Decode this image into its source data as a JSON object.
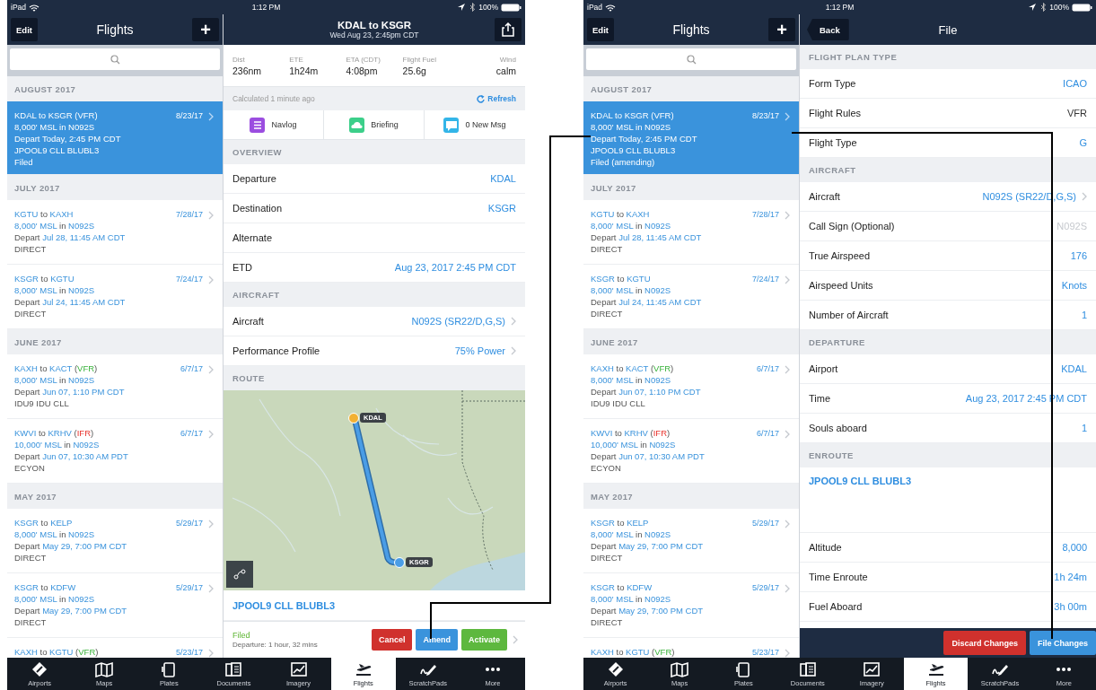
{
  "screens": [
    {
      "kind": "flight",
      "status_bar": {
        "device": "iPad",
        "time": "1:12 PM",
        "battery": "100%"
      },
      "list": {
        "edit": "Edit",
        "title": "Flights",
        "add": "+",
        "sections": [
          {
            "header": "AUGUST 2017",
            "flights": [
              {
                "selected": true,
                "date": "8/23/17",
                "lines": [
                  [
                    {
                      "text": "KDAL to KSGR (VFR)",
                      "kind": "text"
                    }
                  ],
                  [
                    {
                      "text": "8,000' MSL in N092S",
                      "kind": "text"
                    }
                  ],
                  [
                    {
                      "text": "Depart Today, 2:45 PM CDT",
                      "kind": "text"
                    }
                  ],
                  [
                    {
                      "text": "JPOOL9 CLL BLUBL3",
                      "kind": "text"
                    }
                  ],
                  [
                    {
                      "text": "Filed",
                      "kind": "text"
                    }
                  ]
                ]
              }
            ]
          },
          {
            "header": "JULY 2017",
            "flights": [
              {
                "selected": false,
                "date": "7/28/17",
                "lines": [
                  [
                    {
                      "text": "KGTU",
                      "kind": "id"
                    },
                    {
                      "text": " to ",
                      "kind": "text"
                    },
                    {
                      "text": "KAXH",
                      "kind": "id"
                    }
                  ],
                  [
                    {
                      "text": "8,000' MSL",
                      "kind": "id"
                    },
                    {
                      "text": " in ",
                      "kind": "text"
                    },
                    {
                      "text": "N092S",
                      "kind": "id"
                    }
                  ],
                  [
                    {
                      "text": "Depart ",
                      "kind": "text"
                    },
                    {
                      "text": "Jul 28, 11:45 AM CDT",
                      "kind": "id"
                    }
                  ],
                  [
                    {
                      "text": "DIRECT",
                      "kind": "text"
                    }
                  ]
                ]
              },
              {
                "selected": false,
                "date": "7/24/17",
                "lines": [
                  [
                    {
                      "text": "KSGR",
                      "kind": "id"
                    },
                    {
                      "text": " to ",
                      "kind": "text"
                    },
                    {
                      "text": "KGTU",
                      "kind": "id"
                    }
                  ],
                  [
                    {
                      "text": "8,000' MSL",
                      "kind": "id"
                    },
                    {
                      "text": " in ",
                      "kind": "text"
                    },
                    {
                      "text": "N092S",
                      "kind": "id"
                    }
                  ],
                  [
                    {
                      "text": "Depart ",
                      "kind": "text"
                    },
                    {
                      "text": "Jul 24, 11:45 AM CDT",
                      "kind": "id"
                    }
                  ],
                  [
                    {
                      "text": "DIRECT",
                      "kind": "text"
                    }
                  ]
                ]
              }
            ]
          },
          {
            "header": "JUNE 2017",
            "flights": [
              {
                "selected": false,
                "date": "6/7/17",
                "lines": [
                  [
                    {
                      "text": "KAXH",
                      "kind": "id"
                    },
                    {
                      "text": " to ",
                      "kind": "text"
                    },
                    {
                      "text": "KACT",
                      "kind": "id"
                    },
                    {
                      "text": " (",
                      "kind": "text"
                    },
                    {
                      "text": "VFR",
                      "kind": "vfr"
                    },
                    {
                      "text": ")",
                      "kind": "text"
                    }
                  ],
                  [
                    {
                      "text": "8,000' MSL",
                      "kind": "id"
                    },
                    {
                      "text": " in ",
                      "kind": "text"
                    },
                    {
                      "text": "N092S",
                      "kind": "id"
                    }
                  ],
                  [
                    {
                      "text": "Depart ",
                      "kind": "text"
                    },
                    {
                      "text": "Jun 07, 1:10 PM CDT",
                      "kind": "id"
                    }
                  ],
                  [
                    {
                      "text": "IDU9 IDU CLL",
                      "kind": "text"
                    }
                  ]
                ]
              },
              {
                "selected": false,
                "date": "6/7/17",
                "lines": [
                  [
                    {
                      "text": "KWVI",
                      "kind": "id"
                    },
                    {
                      "text": " to ",
                      "kind": "text"
                    },
                    {
                      "text": "KRHV",
                      "kind": "id"
                    },
                    {
                      "text": " (",
                      "kind": "text"
                    },
                    {
                      "text": "IFR",
                      "kind": "ifr"
                    },
                    {
                      "text": ")",
                      "kind": "text"
                    }
                  ],
                  [
                    {
                      "text": "10,000' MSL",
                      "kind": "id"
                    },
                    {
                      "text": " in ",
                      "kind": "text"
                    },
                    {
                      "text": "N092S",
                      "kind": "id"
                    }
                  ],
                  [
                    {
                      "text": "Depart ",
                      "kind": "text"
                    },
                    {
                      "text": "Jun 07, 10:30 AM PDT",
                      "kind": "id"
                    }
                  ],
                  [
                    {
                      "text": "ECYON",
                      "kind": "text"
                    }
                  ]
                ]
              }
            ]
          },
          {
            "header": "MAY 2017",
            "flights": [
              {
                "selected": false,
                "date": "5/29/17",
                "lines": [
                  [
                    {
                      "text": "KSGR",
                      "kind": "id"
                    },
                    {
                      "text": " to ",
                      "kind": "text"
                    },
                    {
                      "text": "KELP",
                      "kind": "id"
                    }
                  ],
                  [
                    {
                      "text": "8,000' MSL",
                      "kind": "id"
                    },
                    {
                      "text": " in ",
                      "kind": "text"
                    },
                    {
                      "text": "N092S",
                      "kind": "id"
                    }
                  ],
                  [
                    {
                      "text": "Depart ",
                      "kind": "text"
                    },
                    {
                      "text": "May 29, 7:00 PM CDT",
                      "kind": "id"
                    }
                  ],
                  [
                    {
                      "text": "DIRECT",
                      "kind": "text"
                    }
                  ]
                ]
              },
              {
                "selected": false,
                "date": "5/29/17",
                "lines": [
                  [
                    {
                      "text": "KSGR",
                      "kind": "id"
                    },
                    {
                      "text": " to ",
                      "kind": "text"
                    },
                    {
                      "text": "KDFW",
                      "kind": "id"
                    }
                  ],
                  [
                    {
                      "text": "8,000' MSL",
                      "kind": "id"
                    },
                    {
                      "text": " in ",
                      "kind": "text"
                    },
                    {
                      "text": "N092S",
                      "kind": "id"
                    }
                  ],
                  [
                    {
                      "text": "Depart ",
                      "kind": "text"
                    },
                    {
                      "text": "May 29, 7:00 PM CDT",
                      "kind": "id"
                    }
                  ],
                  [
                    {
                      "text": "DIRECT",
                      "kind": "text"
                    }
                  ]
                ]
              },
              {
                "selected": false,
                "date": "5/23/17",
                "lines": [
                  [
                    {
                      "text": "KAXH",
                      "kind": "id"
                    },
                    {
                      "text": " to ",
                      "kind": "text"
                    },
                    {
                      "text": "KGTU",
                      "kind": "id"
                    },
                    {
                      "text": " (",
                      "kind": "text"
                    },
                    {
                      "text": "VFR",
                      "kind": "vfr"
                    },
                    {
                      "text": ")",
                      "kind": "text"
                    }
                  ]
                ]
              }
            ]
          }
        ]
      },
      "detail": {
        "title": "KDAL to KSGR",
        "subtitle": "Wed Aug 23, 2:45pm CDT",
        "stats": [
          {
            "label": "Dist",
            "value": "236nm"
          },
          {
            "label": "ETE",
            "value": "1h24m"
          },
          {
            "label": "ETA (CDT)",
            "value": "4:08pm"
          },
          {
            "label": "Flight Fuel",
            "value": "25.6g"
          },
          {
            "label": "Wind",
            "value": "calm"
          }
        ],
        "calculated": "Calculated 1 minute ago",
        "refresh": "Refresh",
        "tiles": [
          {
            "label": "Navlog",
            "kind": "navlog",
            "color": "#9b4de0"
          },
          {
            "label": "Briefing",
            "kind": "briefing",
            "color": "#3ccf8a"
          },
          {
            "label": "0 New Msg",
            "kind": "messages",
            "color": "#33b5e8"
          }
        ],
        "sections": [
          {
            "header": "OVERVIEW",
            "rows": [
              {
                "label": "Departure",
                "value": "KDAL",
                "kind": "link",
                "chevron": false
              },
              {
                "label": "Destination",
                "value": "KSGR",
                "kind": "link",
                "chevron": false
              },
              {
                "label": "Alternate",
                "chevron": false
              },
              {
                "label": "ETD",
                "value": "Aug 23, 2017 2:45 PM CDT",
                "kind": "link",
                "chevron": false
              }
            ]
          },
          {
            "header": "AIRCRAFT",
            "rows": [
              {
                "label": "Aircraft",
                "value": "N092S (SR22/D,G,S)",
                "kind": "link",
                "chevron": true
              },
              {
                "label": "Performance Profile",
                "value": "75% Power",
                "kind": "link",
                "chevron": true
              }
            ]
          },
          {
            "header": "ROUTE",
            "map": {
              "origin": "KDAL",
              "destination": "KSGR"
            },
            "route": "JPOOL9 CLL BLUBL3"
          }
        ],
        "footer": {
          "status": "Filed",
          "note": "Departure: 1 hour, 32 mins",
          "chevron": true,
          "buttons": [
            {
              "label": "Cancel",
              "kind": "danger"
            },
            {
              "label": "Amend",
              "kind": "primary"
            },
            {
              "label": "Activate",
              "kind": "success"
            }
          ]
        }
      },
      "tabs": [
        {
          "label": "Airports",
          "kind": "airports",
          "selected": false
        },
        {
          "label": "Maps",
          "kind": "maps",
          "selected": false
        },
        {
          "label": "Plates",
          "kind": "plates",
          "selected": false
        },
        {
          "label": "Documents",
          "kind": "documents",
          "selected": false
        },
        {
          "label": "Imagery",
          "kind": "imagery",
          "selected": false
        },
        {
          "label": "Flights",
          "kind": "flights",
          "selected": true
        },
        {
          "label": "ScratchPads",
          "kind": "scratchpads",
          "selected": false
        },
        {
          "label": "More",
          "kind": "more",
          "selected": false
        }
      ]
    },
    {
      "kind": "form",
      "status_bar": {
        "device": "iPad",
        "time": "1:12 PM",
        "battery": "100%"
      },
      "list": {
        "edit": "Edit",
        "title": "Flights",
        "add": "+",
        "sections": [
          {
            "header": "AUGUST 2017",
            "flights": [
              {
                "selected": true,
                "date": "8/23/17",
                "lines": [
                  [
                    {
                      "text": "KDAL to KSGR (VFR)",
                      "kind": "text"
                    }
                  ],
                  [
                    {
                      "text": "8,000' MSL in N092S",
                      "kind": "text"
                    }
                  ],
                  [
                    {
                      "text": "Depart Today, 2:45 PM CDT",
                      "kind": "text"
                    }
                  ],
                  [
                    {
                      "text": "JPOOL9 CLL BLUBL3",
                      "kind": "text"
                    }
                  ],
                  [
                    {
                      "text": "Filed (amending)",
                      "kind": "text"
                    }
                  ]
                ]
              }
            ]
          },
          {
            "header": "JULY 2017",
            "flights": [
              {
                "selected": false,
                "date": "7/28/17",
                "lines": [
                  [
                    {
                      "text": "KGTU",
                      "kind": "id"
                    },
                    {
                      "text": " to ",
                      "kind": "text"
                    },
                    {
                      "text": "KAXH",
                      "kind": "id"
                    }
                  ],
                  [
                    {
                      "text": "8,000' MSL",
                      "kind": "id"
                    },
                    {
                      "text": " in ",
                      "kind": "text"
                    },
                    {
                      "text": "N092S",
                      "kind": "id"
                    }
                  ],
                  [
                    {
                      "text": "Depart ",
                      "kind": "text"
                    },
                    {
                      "text": "Jul 28, 11:45 AM CDT",
                      "kind": "id"
                    }
                  ],
                  [
                    {
                      "text": "DIRECT",
                      "kind": "text"
                    }
                  ]
                ]
              },
              {
                "selected": false,
                "date": "7/24/17",
                "lines": [
                  [
                    {
                      "text": "KSGR",
                      "kind": "id"
                    },
                    {
                      "text": " to ",
                      "kind": "text"
                    },
                    {
                      "text": "KGTU",
                      "kind": "id"
                    }
                  ],
                  [
                    {
                      "text": "8,000' MSL",
                      "kind": "id"
                    },
                    {
                      "text": " in ",
                      "kind": "text"
                    },
                    {
                      "text": "N092S",
                      "kind": "id"
                    }
                  ],
                  [
                    {
                      "text": "Depart ",
                      "kind": "text"
                    },
                    {
                      "text": "Jul 24, 11:45 AM CDT",
                      "kind": "id"
                    }
                  ],
                  [
                    {
                      "text": "DIRECT",
                      "kind": "text"
                    }
                  ]
                ]
              }
            ]
          },
          {
            "header": "JUNE 2017",
            "flights": [
              {
                "selected": false,
                "date": "6/7/17",
                "lines": [
                  [
                    {
                      "text": "KAXH",
                      "kind": "id"
                    },
                    {
                      "text": " to ",
                      "kind": "text"
                    },
                    {
                      "text": "KACT",
                      "kind": "id"
                    },
                    {
                      "text": " (",
                      "kind": "text"
                    },
                    {
                      "text": "VFR",
                      "kind": "vfr"
                    },
                    {
                      "text": ")",
                      "kind": "text"
                    }
                  ],
                  [
                    {
                      "text": "8,000' MSL",
                      "kind": "id"
                    },
                    {
                      "text": " in ",
                      "kind": "text"
                    },
                    {
                      "text": "N092S",
                      "kind": "id"
                    }
                  ],
                  [
                    {
                      "text": "Depart ",
                      "kind": "text"
                    },
                    {
                      "text": "Jun 07, 1:10 PM CDT",
                      "kind": "id"
                    }
                  ],
                  [
                    {
                      "text": "IDU9 IDU CLL",
                      "kind": "text"
                    }
                  ]
                ]
              },
              {
                "selected": false,
                "date": "6/7/17",
                "lines": [
                  [
                    {
                      "text": "KWVI",
                      "kind": "id"
                    },
                    {
                      "text": " to ",
                      "kind": "text"
                    },
                    {
                      "text": "KRHV",
                      "kind": "id"
                    },
                    {
                      "text": " (",
                      "kind": "text"
                    },
                    {
                      "text": "IFR",
                      "kind": "ifr"
                    },
                    {
                      "text": ")",
                      "kind": "text"
                    }
                  ],
                  [
                    {
                      "text": "10,000' MSL",
                      "kind": "id"
                    },
                    {
                      "text": " in ",
                      "kind": "text"
                    },
                    {
                      "text": "N092S",
                      "kind": "id"
                    }
                  ],
                  [
                    {
                      "text": "Depart ",
                      "kind": "text"
                    },
                    {
                      "text": "Jun 07, 10:30 AM PDT",
                      "kind": "id"
                    }
                  ],
                  [
                    {
                      "text": "ECYON",
                      "kind": "text"
                    }
                  ]
                ]
              }
            ]
          },
          {
            "header": "MAY 2017",
            "flights": [
              {
                "selected": false,
                "date": "5/29/17",
                "lines": [
                  [
                    {
                      "text": "KSGR",
                      "kind": "id"
                    },
                    {
                      "text": " to ",
                      "kind": "text"
                    },
                    {
                      "text": "KELP",
                      "kind": "id"
                    }
                  ],
                  [
                    {
                      "text": "8,000' MSL",
                      "kind": "id"
                    },
                    {
                      "text": " in ",
                      "kind": "text"
                    },
                    {
                      "text": "N092S",
                      "kind": "id"
                    }
                  ],
                  [
                    {
                      "text": "Depart ",
                      "kind": "text"
                    },
                    {
                      "text": "May 29, 7:00 PM CDT",
                      "kind": "id"
                    }
                  ],
                  [
                    {
                      "text": "DIRECT",
                      "kind": "text"
                    }
                  ]
                ]
              },
              {
                "selected": false,
                "date": "5/29/17",
                "lines": [
                  [
                    {
                      "text": "KSGR",
                      "kind": "id"
                    },
                    {
                      "text": " to ",
                      "kind": "text"
                    },
                    {
                      "text": "KDFW",
                      "kind": "id"
                    }
                  ],
                  [
                    {
                      "text": "8,000' MSL",
                      "kind": "id"
                    },
                    {
                      "text": " in ",
                      "kind": "text"
                    },
                    {
                      "text": "N092S",
                      "kind": "id"
                    }
                  ],
                  [
                    {
                      "text": "Depart ",
                      "kind": "text"
                    },
                    {
                      "text": "May 29, 7:00 PM CDT",
                      "kind": "id"
                    }
                  ],
                  [
                    {
                      "text": "DIRECT",
                      "kind": "text"
                    }
                  ]
                ]
              },
              {
                "selected": false,
                "date": "5/23/17",
                "lines": [
                  [
                    {
                      "text": "KAXH",
                      "kind": "id"
                    },
                    {
                      "text": " to ",
                      "kind": "text"
                    },
                    {
                      "text": "KGTU",
                      "kind": "id"
                    },
                    {
                      "text": " (",
                      "kind": "text"
                    },
                    {
                      "text": "VFR",
                      "kind": "vfr"
                    },
                    {
                      "text": ")",
                      "kind": "text"
                    }
                  ]
                ]
              }
            ]
          }
        ]
      },
      "detail": {
        "back": "Back",
        "title": "File",
        "sections": [
          {
            "header": "FLIGHT PLAN TYPE",
            "rows": [
              {
                "label": "Form Type",
                "value": "ICAO",
                "kind": "link",
                "chevron": false
              },
              {
                "label": "Flight Rules",
                "value": "VFR",
                "kind": "plain",
                "chevron": false
              },
              {
                "label": "Flight Type",
                "value": "G",
                "kind": "link",
                "chevron": false
              }
            ]
          },
          {
            "header": "AIRCRAFT",
            "rows": [
              {
                "label": "Aircraft",
                "value": "N092S (SR22/D,G,S)",
                "kind": "link",
                "chevron": true
              },
              {
                "label": "Call Sign (Optional)",
                "value": "N092S",
                "kind": "muted",
                "chevron": false
              },
              {
                "label": "True Airspeed",
                "value": "176",
                "kind": "link",
                "chevron": false
              },
              {
                "label": "Airspeed Units",
                "value": "Knots",
                "kind": "link",
                "chevron": false
              },
              {
                "label": "Number of Aircraft",
                "value": "1",
                "kind": "link",
                "chevron": false
              }
            ]
          },
          {
            "header": "DEPARTURE",
            "rows": [
              {
                "label": "Airport",
                "value": "KDAL",
                "kind": "link",
                "chevron": false
              },
              {
                "label": "Time",
                "value": "Aug 23, 2017 2:45 PM CDT",
                "kind": "link",
                "chevron": false
              },
              {
                "label": "Souls aboard",
                "value": "1",
                "kind": "link",
                "chevron": false
              }
            ]
          },
          {
            "header": "ENROUTE",
            "route": "JPOOL9 CLL BLUBL3",
            "rows": [
              {
                "label": "Altitude",
                "value": "8,000",
                "kind": "link",
                "chevron": false
              },
              {
                "label": "Time Enroute",
                "value": "1h 24m",
                "kind": "link",
                "chevron": false
              },
              {
                "label": "Fuel Aboard",
                "value": "3h 00m",
                "kind": "link",
                "chevron": false
              }
            ]
          }
        ],
        "footer": {
          "buttons": [
            {
              "label": "Discard Changes",
              "kind": "danger"
            },
            {
              "label": "File Changes",
              "kind": "primary"
            }
          ]
        }
      },
      "tabs": [
        {
          "label": "Airports",
          "kind": "airports",
          "selected": false
        },
        {
          "label": "Maps",
          "kind": "maps",
          "selected": false
        },
        {
          "label": "Plates",
          "kind": "plates",
          "selected": false
        },
        {
          "label": "Documents",
          "kind": "documents",
          "selected": false
        },
        {
          "label": "Imagery",
          "kind": "imagery",
          "selected": false
        },
        {
          "label": "Flights",
          "kind": "flights",
          "selected": true
        },
        {
          "label": "ScratchPads",
          "kind": "scratchpads",
          "selected": false
        },
        {
          "label": "More",
          "kind": "more",
          "selected": false
        }
      ]
    }
  ]
}
